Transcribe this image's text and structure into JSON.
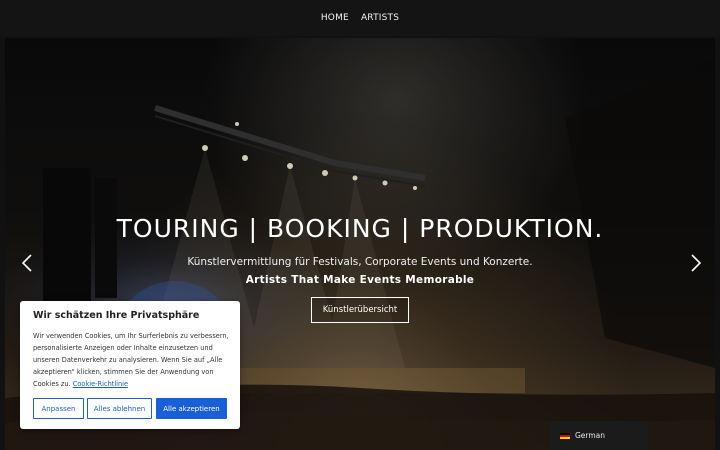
{
  "nav": {
    "home": "HOME",
    "artists": "ARTISTS"
  },
  "hero": {
    "headline": "TOURING | BOOKING | PRODUKTION.",
    "subline": "Künstlervermittlung für Festivals, Corporate Events und Konzerte.",
    "tagline": "Artists That Make Events Memorable",
    "cta_label": "Künstlerübersicht",
    "prev_icon": "chevron-left-icon",
    "next_icon": "chevron-right-icon"
  },
  "cookie_banner": {
    "title": "Wir schätzen Ihre Privatsphäre",
    "body": "Wir verwenden Cookies, um Ihr Surferlebnis zu verbessern, personalisierte Anzeigen oder Inhalte einzusetzen und unseren Datenverkehr zu analysieren. Wenn Sie auf „Alle akzeptieren“ klicken, stimmen Sie der Anwendung von Cookies zu.",
    "policy_link": "Cookie-Richtlinie",
    "customize_label": "Anpassen",
    "reject_label": "Alles ablehnen",
    "accept_label": "Alle akzeptieren",
    "accent_color": "#1a5fd6"
  },
  "language_switcher": {
    "label": "German",
    "flag_icon": "german-flag-icon",
    "flag_colors": [
      "#000000",
      "#dd0000",
      "#ffce00"
    ]
  }
}
